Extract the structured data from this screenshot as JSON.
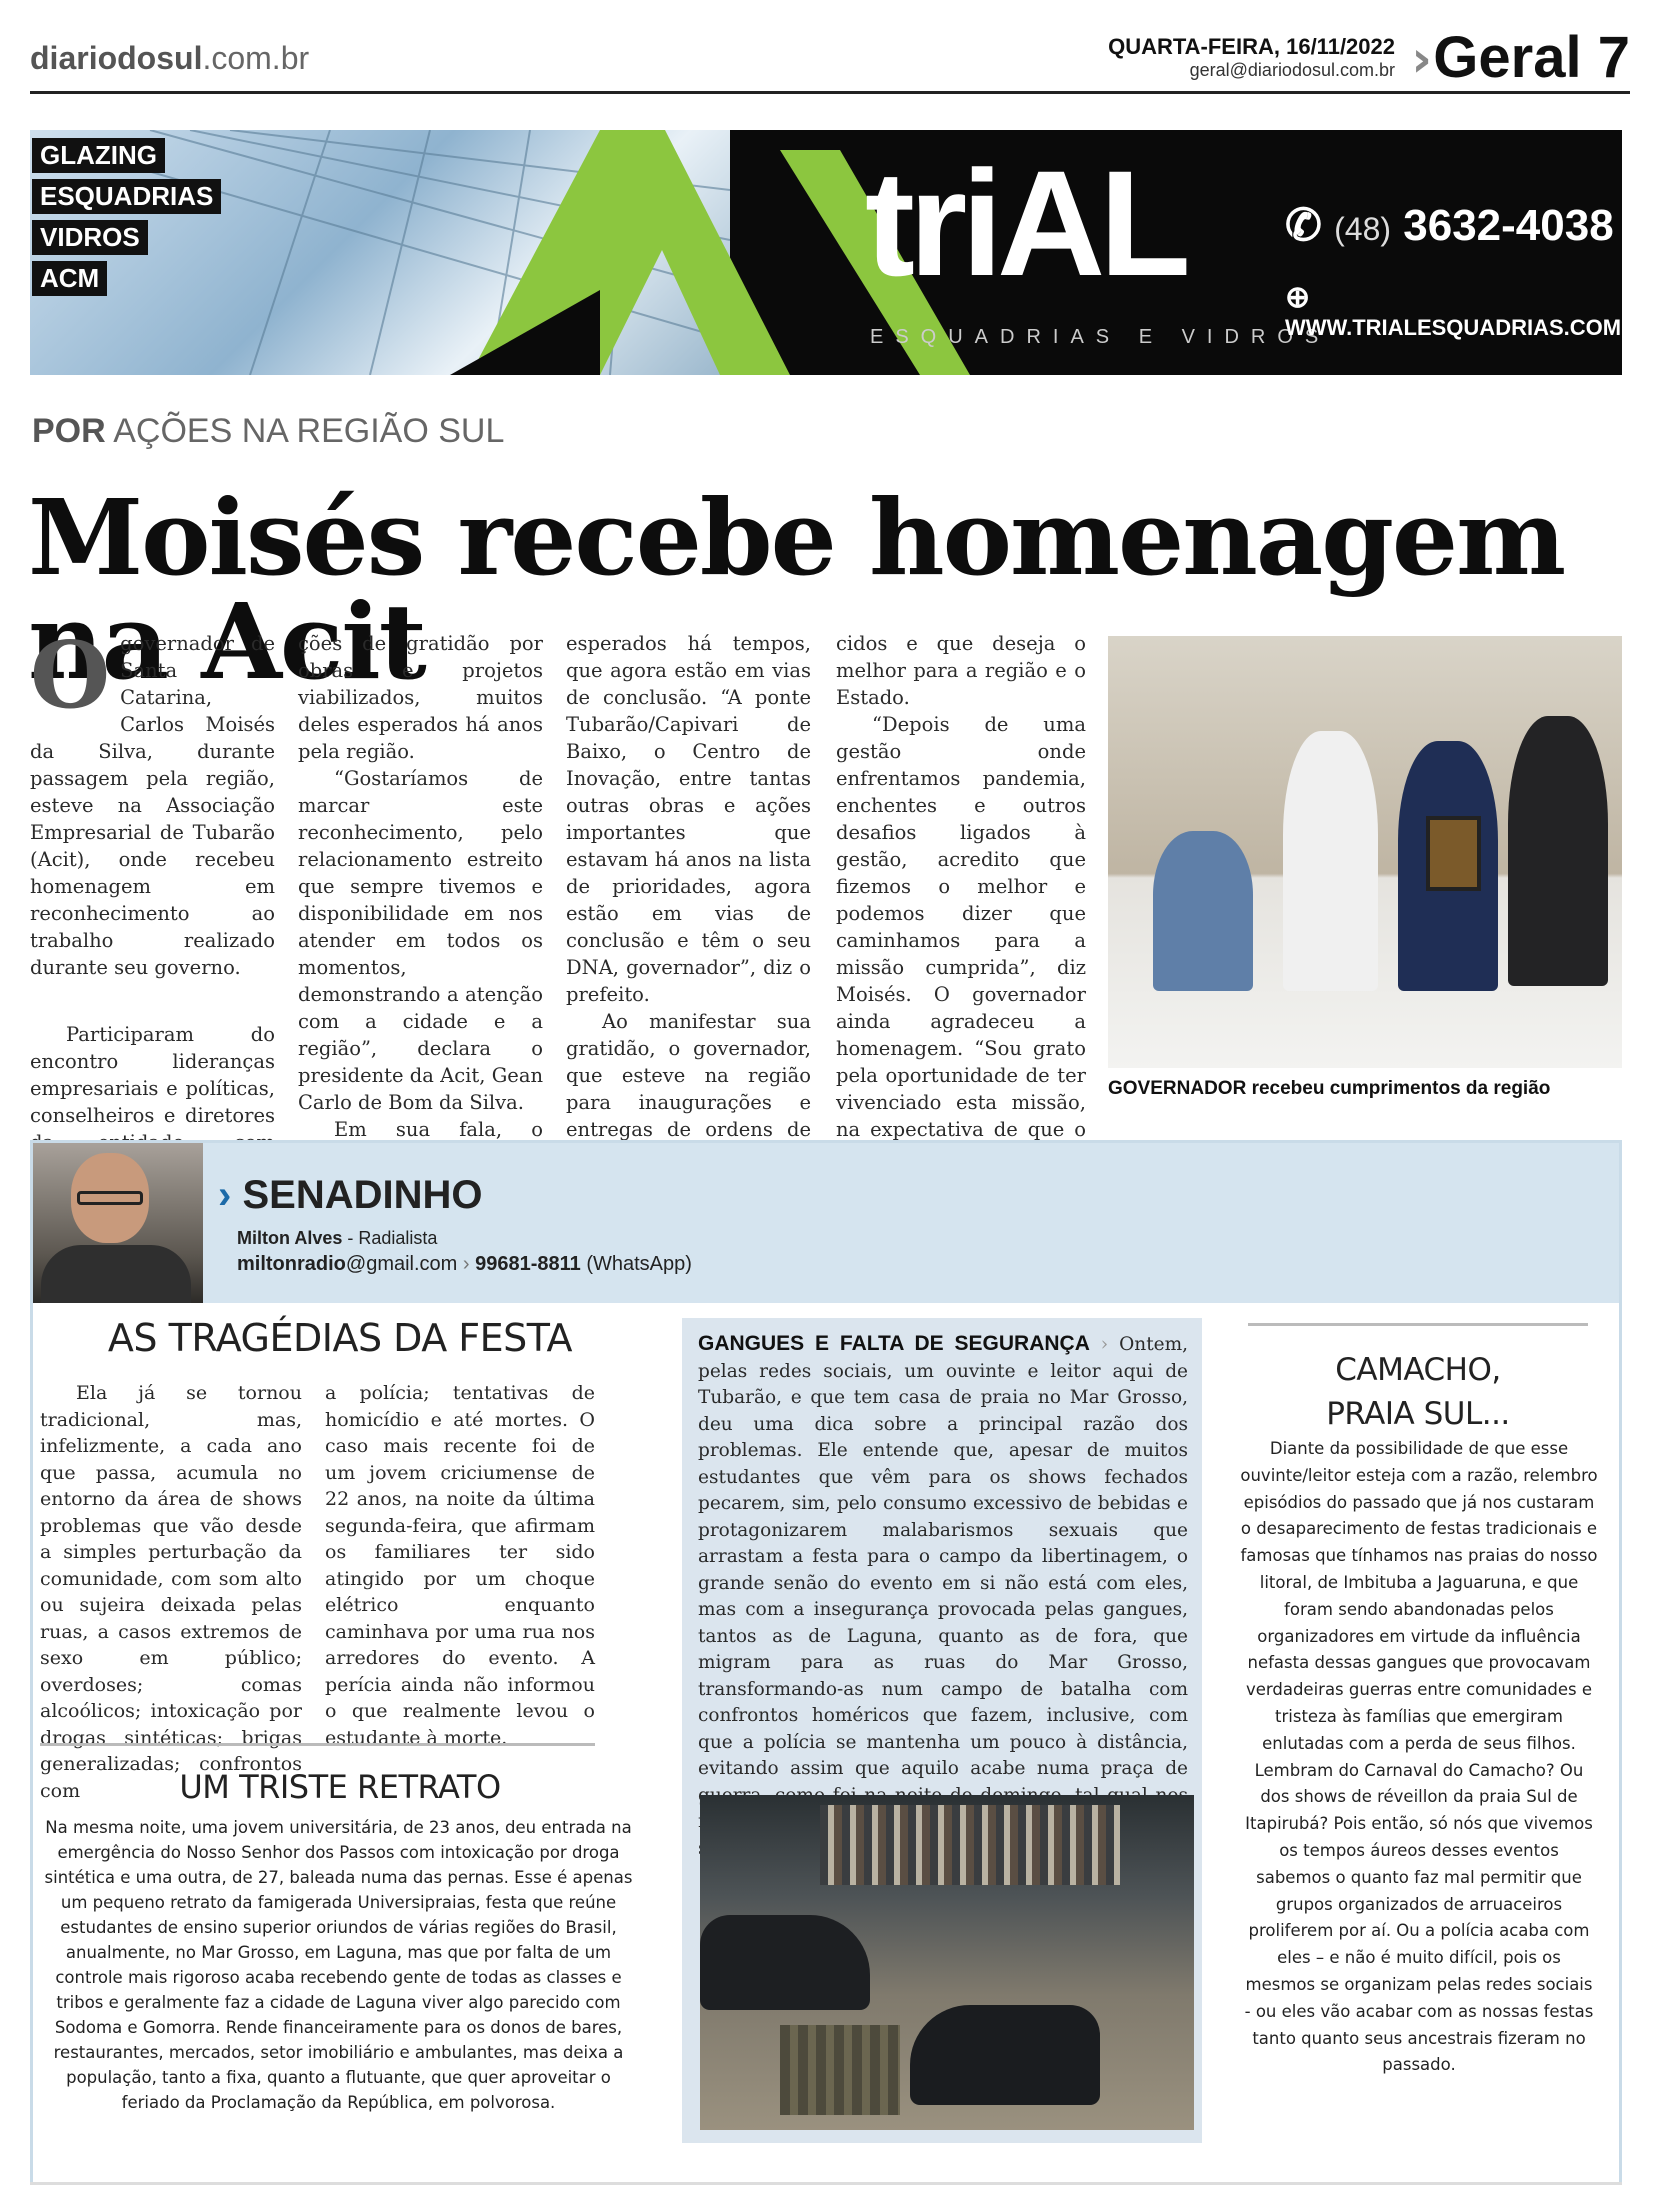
{
  "masthead": {
    "site_bold": "diariodosul",
    "site_rest": ".com.br",
    "date": "QUARTA-FEIRA, 16/11/2022",
    "email": "geral@diariodosul.com.br",
    "section": "Geral",
    "page": "7"
  },
  "ad": {
    "tags": [
      "GLAZING",
      "ESQUADRIAS",
      "VIDROS",
      "ACM"
    ],
    "logo": "triAL",
    "subtitle": "ESQUADRIAS E VIDROS",
    "phone_area": "(48)",
    "phone": "3632-4038",
    "website": "WWW.TRIALESQUADRIAS.COM",
    "accent_color": "#8cc63f"
  },
  "article": {
    "kicker_bold": "POR",
    "kicker_rest": " AÇÕES NA REGIÃO SUL",
    "headline": "Moisés recebe homenagem na Acit",
    "dropcap": "O",
    "col1_p1": "governador de Santa Catarina, Carlos Moisés da Silva, durante passagem pela região, esteve na Associação Empresarial de Tubarão (Acit), onde recebeu homenagem em reconhecimento ao trabalho realizado durante seu governo.",
    "col1_p2": "Participaram do encontro lideranças empresariais e políticas, conselheiros e diretores da entidade, com manifesta-",
    "col2_p1": "ções de gratidão por obras e projetos viabilizados, muitos deles esperados há anos pela região.",
    "col2_p2": "“Gostaríamos de marcar este reconhecimento, pelo relacionamento estreito que sempre tivemos e disponibilidade em nos atender em todos os momentos, demonstrando a atenção com a cidade e a região”, declara o presidente da Acit, Gean Carlo de Bom da Silva.",
    "col2_p3": "Em sua fala, o prefeito de Tubarão, Joares Ponticelli, lembrou de pleitos",
    "col3_p1": "esperados há tempos, que agora estão em vias de conclusão. “A ponte Tubarão/Capivari de Baixo, o Centro de Inovação, entre tantas outras obras e ações importantes que estavam há anos na lista de prioridades, agora estão em vias de conclusão e têm o seu DNA, governador”, diz o prefeito.",
    "col3_p2": "Ao manifestar sua gratidão, o governador, que esteve na região para inaugurações e entregas de ordens de serviço, disse que foram muitos desafios ven-",
    "col4_p1": "cidos e que deseja o melhor para a região e o Estado.",
    "col4_p2": "“Depois de uma gestão onde enfrentamos pandemia, enchentes e outros desafios ligados à gestão, acredito que fizemos o melhor e podemos dizer que caminhamos para a missão cumprida”, diz Moisés. O governador ainda agradeceu a homenagem. “Sou grato pela oportunidade de ter vivenciado esta missão, na expectativa de que o Estado continue crescendo e se desenvolvendo”, afirma Carlos Moisés.",
    "caption": "GOVERNADOR recebeu cumprimentos da região"
  },
  "column": {
    "name": "SENADINHO",
    "author_name": "Milton Alves",
    "author_role": " - Radialista",
    "email_bold": "miltonradio",
    "email_rest": "@gmail.com",
    "phone": "99681-8811",
    "phone_note": " (WhatsApp)",
    "accent_color": "#1c6aa8"
  },
  "tragedias": {
    "title": "AS TRAGÉDIAS DA FESTA",
    "col1": "Ela já se tornou tradicional, mas, infelizmente, a cada ano que passa, acumula no entorno da área de shows problemas que vão desde a simples perturbação da comunidade, com som alto ou sujeira deixada pelas ruas, a casos extremos de sexo em público; overdoses; comas alcoólicos; intoxicação por drogas sintéticas; brigas generalizadas; confrontos com",
    "col2": "a polícia; tentativas de homicídio e até mortes. O caso mais recente foi de um jovem criciumense de 22 anos, na noite da última segunda-feira, que afirmam os familiares ter sido atingido por um choque elétrico enquanto caminhava por uma rua nos arredores do evento. A perícia ainda não informou o que realmente levou o estudante à morte."
  },
  "retrato": {
    "title": "UM TRISTE RETRATO",
    "body": "Na mesma noite, uma jovem universitária, de 23 anos, deu entrada na emergência do Nosso Senhor dos Passos com intoxicação por droga sintética e uma outra, de 27, baleada numa das pernas. Esse é apenas um pequeno retrato da famigerada Universipraias, festa que reúne estudantes de ensino superior oriundos de várias regiões do Brasil, anualmente, no Mar Grosso, em Laguna, mas que por falta de um controle mais rigoroso acaba recebendo gente de todas as classes e tribos e geralmente faz a cidade de Laguna viver algo parecido com Sodoma e Gomorra. Rende financeiramente para os donos de bares, restaurantes, mercados, setor imobiliário e ambulantes, mas deixa a população, tanto a fixa, quanto a flutuante, que quer aproveitar o feriado da Proclamação da República, em polvorosa."
  },
  "gangues": {
    "title": "GANGUES E FALTA DE SEGURANÇA",
    "body": "Ontem, pelas redes sociais, um ouvinte e leitor aqui de Tubarão, e que tem casa de praia no Mar Grosso, deu uma dica sobre a principal razão dos problemas. Ele entende que, apesar de muitos estudantes que vêm para os shows fechados pecarem, sim, pelo consumo excessivo de bebidas e protagonizarem malabarismos sexuais que arrastam a festa para o campo da libertinagem, o grande senão do evento em si não está com eles, mas com a insegurança provocada pelas gangues, tantos as de Laguna, quanto as de fora, que migram para as ruas do Mar Grosso, transformando-as num campo de batalha com confrontos homéricos que fazem, inclusive, com que a polícia se mantenha um pouco à distância, evitando assim que aquilo acabe numa praça de guerra, como foi na noite de domingo, tal qual nos mostra essa reprodução de um vídeo das redes sociais."
  },
  "camacho": {
    "title_line1": "CAMACHO,",
    "title_line2": "PRAIA SUL...",
    "body": "Diante da possibilidade de que esse ouvinte/leitor esteja com a razão, relembro episódios do passado que já nos custaram o desaparecimento de festas tradicionais e famosas que tínhamos nas praias do nosso litoral, de Imbituba a Jaguaruna, e que foram sendo abandonadas pelos organizadores em virtude da influência nefasta dessas gangues que provocavam verdadeiras guerras entre comunidades e tristeza às famílias que emergiram enlutadas com a perda de seus filhos. Lembram do Carnaval do Camacho? Ou dos shows de réveillon da praia Sul de Itapirubá? Pois então, só nós que vivemos os tempos áureos desses eventos sabemos o quanto faz mal permitir que grupos organizados de arruaceiros proliferem por aí. Ou a polícia acaba com eles – e não é muito difícil, pois os mesmos se organizam pelas redes sociais - ou eles vão acabar com as nossas festas tanto quanto seus ancestrais fizeram no passado."
  }
}
